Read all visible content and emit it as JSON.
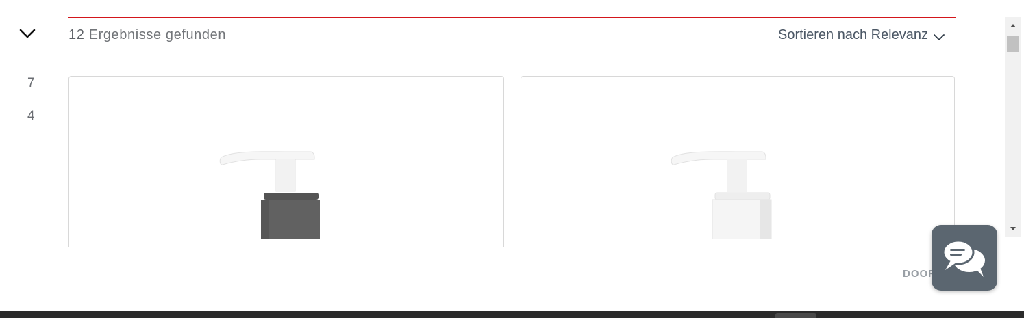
{
  "facets": {
    "toggle_icon": "chevron-down-icon",
    "counts": [
      "7",
      "4"
    ]
  },
  "results": {
    "count": "12",
    "count_label": "Ergebnisse gefunden",
    "sort_label": "Sortieren nach Relevanz",
    "sort_icon": "chevron-down-icon"
  },
  "products": [
    {
      "image": "pump-dispenser-dark-grey",
      "collar_color": "#5f5f5f"
    },
    {
      "image": "pump-dispenser-white",
      "collar_color": "#f4f4f4"
    }
  ],
  "branding": {
    "logo": "DOOFINDER"
  },
  "chat": {
    "icon": "chat-bubbles-icon"
  },
  "colors": {
    "border_accent": "#d3161b",
    "chat_bg": "#5b6670",
    "text": "#727579"
  }
}
